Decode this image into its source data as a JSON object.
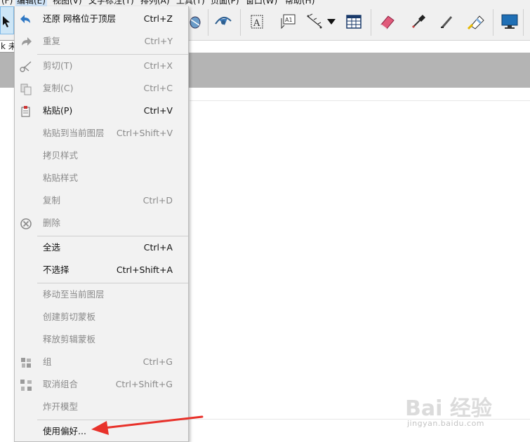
{
  "menubar": {
    "items": [
      {
        "label": "(F)"
      },
      {
        "label": "编辑(E)"
      },
      {
        "label": "视图(V)"
      },
      {
        "label": "文字标注(T)"
      },
      {
        "label": "排列(A)"
      },
      {
        "label": "工具(T)"
      },
      {
        "label": "页面(P)"
      },
      {
        "label": "窗口(W)"
      },
      {
        "label": "帮助(H)"
      }
    ]
  },
  "toolbar": {
    "icons": [
      "cursor-icon",
      "globe-tool-icon",
      "align-text-icon",
      "label-text-icon",
      "dimension-icon",
      "dropdown-arrow-icon",
      "table-icon",
      "eraser-icon",
      "eyedropper-icon",
      "knife-icon",
      "fill-icon",
      "display-icon"
    ]
  },
  "tab": {
    "label": "k 未"
  },
  "edit_menu": {
    "items": [
      {
        "label": "还原 网格位于顶层",
        "shortcut": "Ctrl+Z",
        "enabled": true,
        "icon": "undo-icon"
      },
      {
        "label": "重复",
        "shortcut": "Ctrl+Y",
        "enabled": false,
        "icon": "redo-icon"
      },
      {
        "label": "剪切(T)",
        "shortcut": "Ctrl+X",
        "enabled": false,
        "icon": "scissors-icon"
      },
      {
        "label": "复制(C)",
        "shortcut": "Ctrl+C",
        "enabled": false,
        "icon": "copy-icon"
      },
      {
        "label": "粘贴(P)",
        "shortcut": "Ctrl+V",
        "enabled": true,
        "icon": "paste-icon"
      },
      {
        "label": "粘贴到当前图层",
        "shortcut": "Ctrl+Shift+V",
        "enabled": false,
        "icon": ""
      },
      {
        "label": "拷贝样式",
        "shortcut": "",
        "enabled": false,
        "icon": ""
      },
      {
        "label": "粘贴样式",
        "shortcut": "",
        "enabled": false,
        "icon": ""
      },
      {
        "label": "复制",
        "shortcut": "Ctrl+D",
        "enabled": false,
        "icon": ""
      },
      {
        "label": "删除",
        "shortcut": "",
        "enabled": false,
        "icon": "delete-icon"
      },
      {
        "label": "全选",
        "shortcut": "Ctrl+A",
        "enabled": true,
        "icon": ""
      },
      {
        "label": "不选择",
        "shortcut": "Ctrl+Shift+A",
        "enabled": true,
        "icon": ""
      },
      {
        "label": "移动至当前图层",
        "shortcut": "",
        "enabled": false,
        "icon": ""
      },
      {
        "label": "创建剪切蒙板",
        "shortcut": "",
        "enabled": false,
        "icon": ""
      },
      {
        "label": "释放剪辑蒙板",
        "shortcut": "",
        "enabled": false,
        "icon": ""
      },
      {
        "label": "组",
        "shortcut": "Ctrl+G",
        "enabled": false,
        "icon": "group-icon"
      },
      {
        "label": "取消组合",
        "shortcut": "Ctrl+Shift+G",
        "enabled": false,
        "icon": "ungroup-icon"
      },
      {
        "label": "炸开模型",
        "shortcut": "",
        "enabled": false,
        "icon": ""
      },
      {
        "label": "使用偏好...",
        "shortcut": "",
        "enabled": true,
        "icon": ""
      }
    ]
  },
  "colors": {
    "annotation_arrow": "#e8322b",
    "menu_background": "#f2f2f2",
    "toolbar_background": "#f0f0f0",
    "grey_band": "#b4b4b4"
  },
  "watermark": {
    "main": "Bai 经验",
    "sub": "jingyan.baidu.com"
  }
}
